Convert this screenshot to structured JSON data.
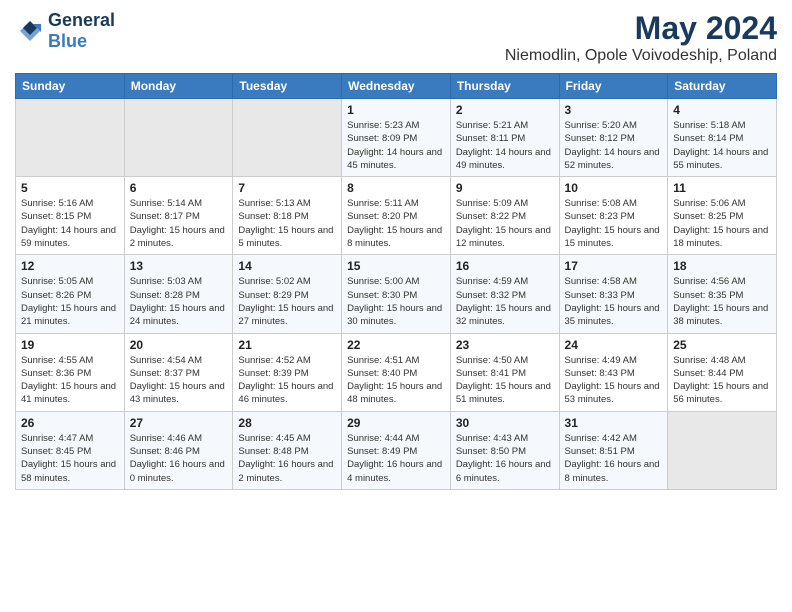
{
  "header": {
    "logo_general": "General",
    "logo_blue": "Blue",
    "main_title": "May 2024",
    "subtitle": "Niemodlin, Opole Voivodeship, Poland"
  },
  "calendar": {
    "days_of_week": [
      "Sunday",
      "Monday",
      "Tuesday",
      "Wednesday",
      "Thursday",
      "Friday",
      "Saturday"
    ],
    "weeks": [
      [
        {
          "day": "",
          "info": ""
        },
        {
          "day": "",
          "info": ""
        },
        {
          "day": "",
          "info": ""
        },
        {
          "day": "1",
          "info": "Sunrise: 5:23 AM\nSunset: 8:09 PM\nDaylight: 14 hours and 45 minutes."
        },
        {
          "day": "2",
          "info": "Sunrise: 5:21 AM\nSunset: 8:11 PM\nDaylight: 14 hours and 49 minutes."
        },
        {
          "day": "3",
          "info": "Sunrise: 5:20 AM\nSunset: 8:12 PM\nDaylight: 14 hours and 52 minutes."
        },
        {
          "day": "4",
          "info": "Sunrise: 5:18 AM\nSunset: 8:14 PM\nDaylight: 14 hours and 55 minutes."
        }
      ],
      [
        {
          "day": "5",
          "info": "Sunrise: 5:16 AM\nSunset: 8:15 PM\nDaylight: 14 hours and 59 minutes."
        },
        {
          "day": "6",
          "info": "Sunrise: 5:14 AM\nSunset: 8:17 PM\nDaylight: 15 hours and 2 minutes."
        },
        {
          "day": "7",
          "info": "Sunrise: 5:13 AM\nSunset: 8:18 PM\nDaylight: 15 hours and 5 minutes."
        },
        {
          "day": "8",
          "info": "Sunrise: 5:11 AM\nSunset: 8:20 PM\nDaylight: 15 hours and 8 minutes."
        },
        {
          "day": "9",
          "info": "Sunrise: 5:09 AM\nSunset: 8:22 PM\nDaylight: 15 hours and 12 minutes."
        },
        {
          "day": "10",
          "info": "Sunrise: 5:08 AM\nSunset: 8:23 PM\nDaylight: 15 hours and 15 minutes."
        },
        {
          "day": "11",
          "info": "Sunrise: 5:06 AM\nSunset: 8:25 PM\nDaylight: 15 hours and 18 minutes."
        }
      ],
      [
        {
          "day": "12",
          "info": "Sunrise: 5:05 AM\nSunset: 8:26 PM\nDaylight: 15 hours and 21 minutes."
        },
        {
          "day": "13",
          "info": "Sunrise: 5:03 AM\nSunset: 8:28 PM\nDaylight: 15 hours and 24 minutes."
        },
        {
          "day": "14",
          "info": "Sunrise: 5:02 AM\nSunset: 8:29 PM\nDaylight: 15 hours and 27 minutes."
        },
        {
          "day": "15",
          "info": "Sunrise: 5:00 AM\nSunset: 8:30 PM\nDaylight: 15 hours and 30 minutes."
        },
        {
          "day": "16",
          "info": "Sunrise: 4:59 AM\nSunset: 8:32 PM\nDaylight: 15 hours and 32 minutes."
        },
        {
          "day": "17",
          "info": "Sunrise: 4:58 AM\nSunset: 8:33 PM\nDaylight: 15 hours and 35 minutes."
        },
        {
          "day": "18",
          "info": "Sunrise: 4:56 AM\nSunset: 8:35 PM\nDaylight: 15 hours and 38 minutes."
        }
      ],
      [
        {
          "day": "19",
          "info": "Sunrise: 4:55 AM\nSunset: 8:36 PM\nDaylight: 15 hours and 41 minutes."
        },
        {
          "day": "20",
          "info": "Sunrise: 4:54 AM\nSunset: 8:37 PM\nDaylight: 15 hours and 43 minutes."
        },
        {
          "day": "21",
          "info": "Sunrise: 4:52 AM\nSunset: 8:39 PM\nDaylight: 15 hours and 46 minutes."
        },
        {
          "day": "22",
          "info": "Sunrise: 4:51 AM\nSunset: 8:40 PM\nDaylight: 15 hours and 48 minutes."
        },
        {
          "day": "23",
          "info": "Sunrise: 4:50 AM\nSunset: 8:41 PM\nDaylight: 15 hours and 51 minutes."
        },
        {
          "day": "24",
          "info": "Sunrise: 4:49 AM\nSunset: 8:43 PM\nDaylight: 15 hours and 53 minutes."
        },
        {
          "day": "25",
          "info": "Sunrise: 4:48 AM\nSunset: 8:44 PM\nDaylight: 15 hours and 56 minutes."
        }
      ],
      [
        {
          "day": "26",
          "info": "Sunrise: 4:47 AM\nSunset: 8:45 PM\nDaylight: 15 hours and 58 minutes."
        },
        {
          "day": "27",
          "info": "Sunrise: 4:46 AM\nSunset: 8:46 PM\nDaylight: 16 hours and 0 minutes."
        },
        {
          "day": "28",
          "info": "Sunrise: 4:45 AM\nSunset: 8:48 PM\nDaylight: 16 hours and 2 minutes."
        },
        {
          "day": "29",
          "info": "Sunrise: 4:44 AM\nSunset: 8:49 PM\nDaylight: 16 hours and 4 minutes."
        },
        {
          "day": "30",
          "info": "Sunrise: 4:43 AM\nSunset: 8:50 PM\nDaylight: 16 hours and 6 minutes."
        },
        {
          "day": "31",
          "info": "Sunrise: 4:42 AM\nSunset: 8:51 PM\nDaylight: 16 hours and 8 minutes."
        },
        {
          "day": "",
          "info": ""
        }
      ]
    ]
  }
}
